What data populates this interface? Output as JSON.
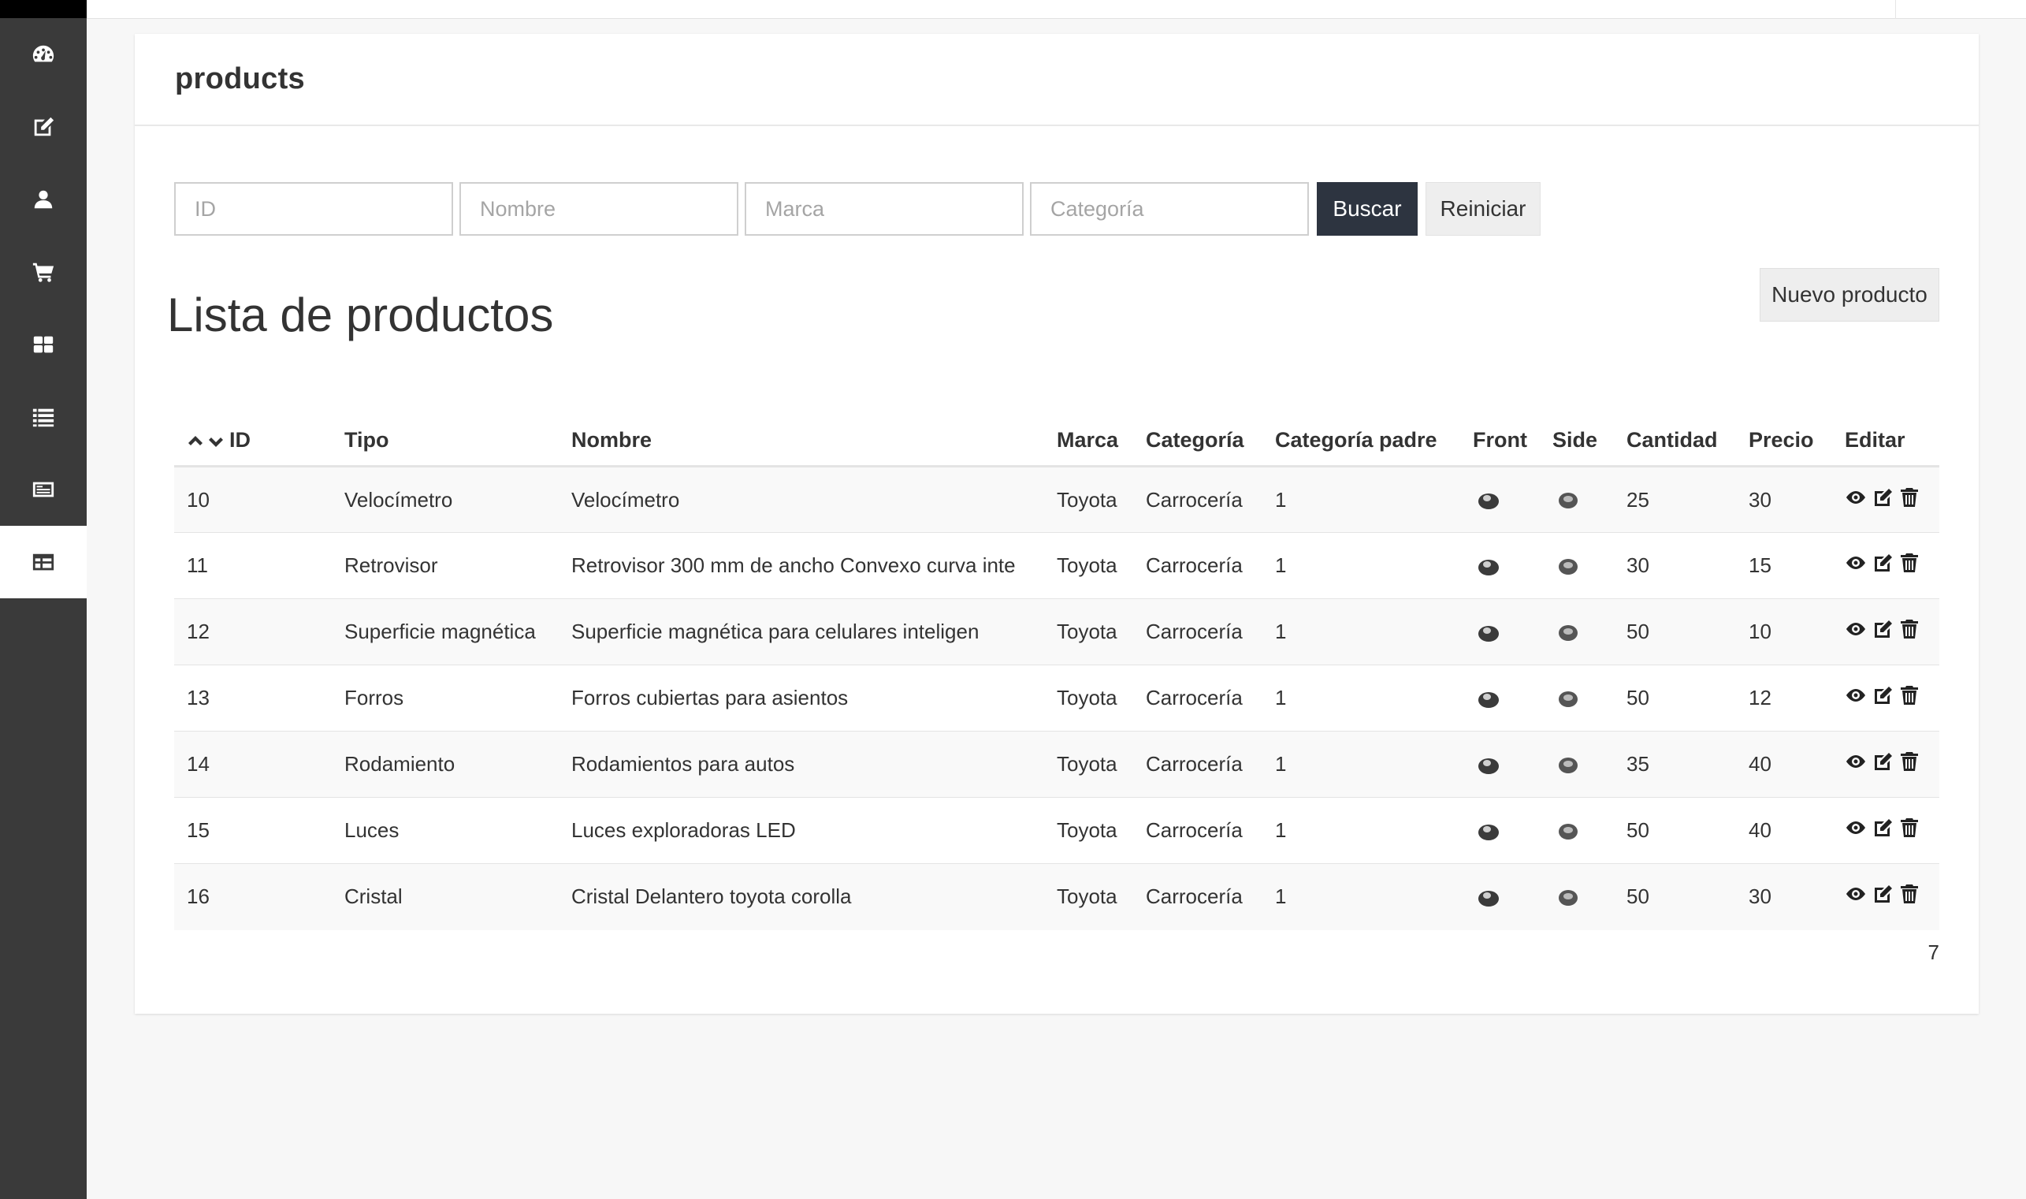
{
  "panel": {
    "title": "products"
  },
  "search": {
    "id_placeholder": "ID",
    "name_placeholder": "Nombre",
    "brand_placeholder": "Marca",
    "category_placeholder": "Categoría",
    "search_label": "Buscar",
    "reset_label": "Reiniciar"
  },
  "list": {
    "title": "Lista de productos",
    "new_label": "Nuevo producto"
  },
  "table": {
    "headers": [
      "ID",
      "Tipo",
      "Nombre",
      "Marca",
      "Categoría",
      "Categoría padre",
      "Front",
      "Side",
      "Cantidad",
      "Precio",
      "Editar"
    ],
    "rows": [
      {
        "id": "10",
        "tipo": "Velocímetro",
        "nombre": "Velocímetro",
        "marca": "Toyota",
        "categoria": "Carrocería",
        "padre": "1",
        "cantidad": "25",
        "precio": "30"
      },
      {
        "id": "11",
        "tipo": "Retrovisor",
        "nombre": "Retrovisor 300 mm de ancho Convexo curva inte",
        "marca": "Toyota",
        "categoria": "Carrocería",
        "padre": "1",
        "cantidad": "30",
        "precio": "15"
      },
      {
        "id": "12",
        "tipo": "Superficie magnética",
        "nombre": "Superficie magnética para celulares inteligen",
        "marca": "Toyota",
        "categoria": "Carrocería",
        "padre": "1",
        "cantidad": "50",
        "precio": "10"
      },
      {
        "id": "13",
        "tipo": "Forros",
        "nombre": "Forros cubiertas para asientos",
        "marca": "Toyota",
        "categoria": "Carrocería",
        "padre": "1",
        "cantidad": "50",
        "precio": "12"
      },
      {
        "id": "14",
        "tipo": "Rodamiento",
        "nombre": "Rodamientos para autos",
        "marca": "Toyota",
        "categoria": "Carrocería",
        "padre": "1",
        "cantidad": "35",
        "precio": "40"
      },
      {
        "id": "15",
        "tipo": "Luces",
        "nombre": "Luces exploradoras LED",
        "marca": "Toyota",
        "categoria": "Carrocería",
        "padre": "1",
        "cantidad": "50",
        "precio": "40"
      },
      {
        "id": "16",
        "tipo": "Cristal",
        "nombre": "Cristal Delantero toyota corolla",
        "marca": "Toyota",
        "categoria": "Carrocería",
        "padre": "1",
        "cantidad": "50",
        "precio": "30"
      }
    ]
  },
  "pagination": {
    "count": "7"
  },
  "sidebar": {
    "items": [
      {
        "icon": "dashboard-icon"
      },
      {
        "icon": "edit-icon"
      },
      {
        "icon": "user-icon"
      },
      {
        "icon": "cart-icon"
      },
      {
        "icon": "grid-icon"
      },
      {
        "icon": "list-icon"
      },
      {
        "icon": "newspaper-icon"
      },
      {
        "icon": "table-icon",
        "active": true
      }
    ]
  }
}
